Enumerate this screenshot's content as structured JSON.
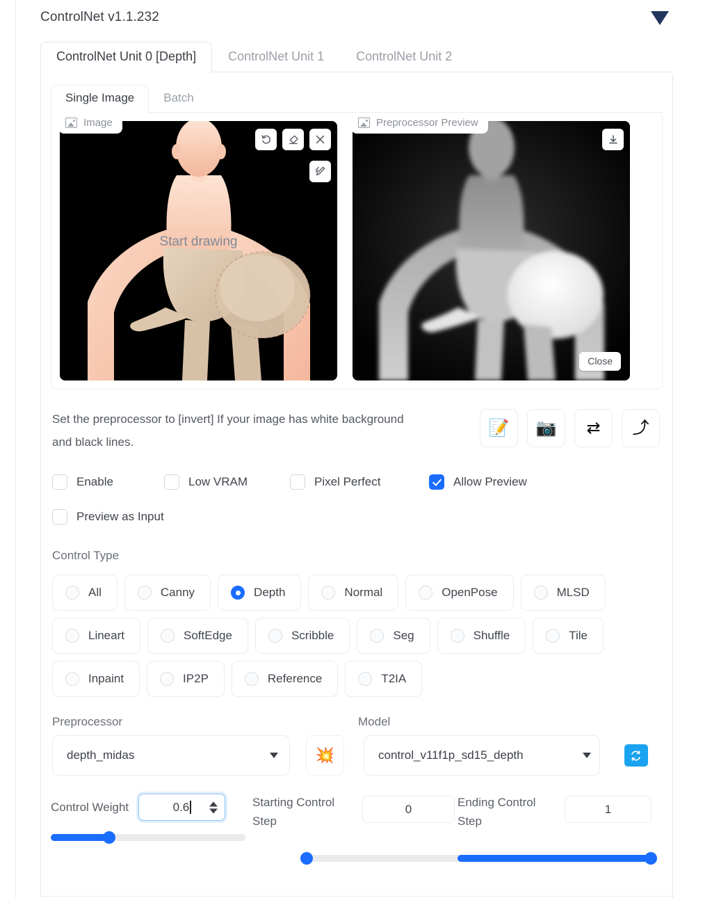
{
  "header": {
    "title": "ControlNet v1.1.232",
    "collapse_icon": "caret-down-icon",
    "accent_color": "#1a6dff",
    "caret_color": "#22365c"
  },
  "unit_tabs": [
    {
      "label": "ControlNet Unit 0 [Depth]",
      "active": true
    },
    {
      "label": "ControlNet Unit 1",
      "active": false
    },
    {
      "label": "ControlNet Unit 2",
      "active": false
    }
  ],
  "source_tabs": [
    {
      "label": "Single Image",
      "active": true
    },
    {
      "label": "Batch",
      "active": false
    }
  ],
  "image_pane": {
    "badge_label": "Image",
    "badge_icon": "image-icon",
    "overlay_text": "Start drawing",
    "tools": [
      {
        "name": "undo-icon",
        "glyph": "↺"
      },
      {
        "name": "eraser-icon",
        "glyph": "▱"
      },
      {
        "name": "close-icon",
        "glyph": "✕"
      }
    ],
    "brush_tool": {
      "name": "brush-icon",
      "glyph": "✐"
    }
  },
  "preview_pane": {
    "badge_label": "Preprocessor Preview",
    "badge_icon": "image-icon",
    "download_icon": "download-icon",
    "close_label": "Close"
  },
  "hint": {
    "text": "Set the preprocessor to [invert] If your image has white background and black lines.",
    "buttons": [
      {
        "name": "open-new-canvas-button",
        "glyph": "📝"
      },
      {
        "name": "webcam-button",
        "glyph": "📷"
      },
      {
        "name": "mirror-webcam-button",
        "glyph": "⇄"
      },
      {
        "name": "send-dimensions-button",
        "glyph": "⤴"
      }
    ]
  },
  "checkboxes": [
    {
      "label": "Enable",
      "checked": false
    },
    {
      "label": "Low VRAM",
      "checked": false
    },
    {
      "label": "Pixel Perfect",
      "checked": false
    },
    {
      "label": "Allow Preview",
      "checked": true
    },
    {
      "label": "Preview as Input",
      "checked": false
    }
  ],
  "control_type": {
    "label": "Control Type",
    "selected": "Depth",
    "rows": [
      [
        {
          "label": "All",
          "selected": false
        },
        {
          "label": "Canny",
          "selected": false
        },
        {
          "label": "Depth",
          "selected": true
        },
        {
          "label": "Normal",
          "selected": false
        },
        {
          "label": "OpenPose",
          "selected": false
        },
        {
          "label": "MLSD",
          "selected": false
        }
      ],
      [
        {
          "label": "Lineart",
          "selected": false
        },
        {
          "label": "SoftEdge",
          "selected": false
        },
        {
          "label": "Scribble",
          "selected": false
        },
        {
          "label": "Seg",
          "selected": false
        },
        {
          "label": "Shuffle",
          "selected": false
        },
        {
          "label": "Tile",
          "selected": false
        }
      ],
      [
        {
          "label": "Inpaint",
          "selected": false
        },
        {
          "label": "IP2P",
          "selected": false
        },
        {
          "label": "Reference",
          "selected": false
        },
        {
          "label": "T2IA",
          "selected": false
        }
      ]
    ]
  },
  "preprocessor": {
    "label": "Preprocessor",
    "value": "depth_midas",
    "run_button": {
      "name": "run-preprocessor-button",
      "glyph": "💥"
    }
  },
  "model": {
    "label": "Model",
    "value": "control_v11f1p_sd15_depth",
    "refresh_button": {
      "name": "refresh-models-button",
      "glyph": "↻"
    }
  },
  "sliders": {
    "control_weight": {
      "label": "Control Weight",
      "value": "0.6",
      "min": 0,
      "max": 2,
      "fill_percent": 30,
      "focused": true
    },
    "starting_control_step": {
      "label": "Starting Control Step",
      "value": "0",
      "min": 0,
      "max": 1,
      "fill_percent": 0,
      "focused": false
    },
    "ending_control_step": {
      "label": "Ending Control Step",
      "value": "1",
      "min": 0,
      "max": 1,
      "fill_percent": 100,
      "focused": false
    }
  }
}
